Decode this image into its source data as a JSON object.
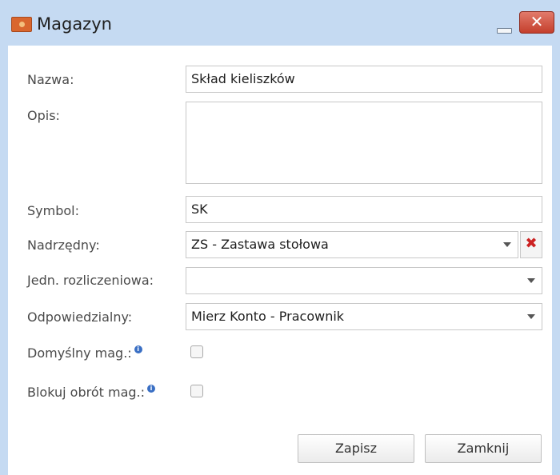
{
  "window": {
    "title": "Magazyn",
    "close_symbol": "✕"
  },
  "form": {
    "name_label": "Nazwa:",
    "name_value": "Skład kieliszków",
    "desc_label": "Opis:",
    "desc_value": "",
    "symbol_label": "Symbol:",
    "symbol_value": "SK",
    "parent_label": "Nadrzędny:",
    "parent_value": "ZS - Zastawa stołowa",
    "parent_clear_symbol": "✖",
    "unit_label": "Jedn. rozliczeniowa:",
    "unit_value": "",
    "responsible_label": "Odpowiedzialny:",
    "responsible_value": "Mierz Konto - Pracownik",
    "default_label": "Domyślny mag.:",
    "default_checked": false,
    "block_label": "Blokuj obrót mag.:",
    "block_checked": false,
    "info_symbol": "i"
  },
  "buttons": {
    "save": "Zapisz",
    "close": "Zamknij"
  },
  "colors": {
    "titlebar": "#c5daf2",
    "close_button": "#c43f2c",
    "info_icon": "#3a6fc4",
    "clear_icon": "#cc2222"
  }
}
